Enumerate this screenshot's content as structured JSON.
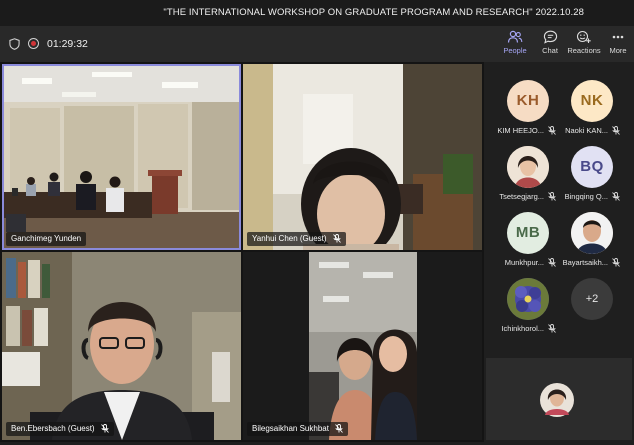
{
  "window": {
    "title": "\"THE INTERNATIONAL WORKSHOP ON GRADUATE PROGRAM AND RESEARCH\" 2022.10.28"
  },
  "toolbar": {
    "timer": "01:29:32",
    "people_label": "People",
    "chat_label": "Chat",
    "reactions_label": "Reactions",
    "more_label": "More"
  },
  "tiles": [
    {
      "name": "Ganchimeg Yunden"
    },
    {
      "name": "Yanhui Chen (Guest)"
    },
    {
      "name": "Ben.Ebersbach (Guest)"
    },
    {
      "name": "Bilegsaikhan Sukhbat"
    }
  ],
  "roster": [
    {
      "initials": "KH",
      "name": "KIM HEEJO...",
      "color": "#f6dcc4",
      "text_color": "#9a5b2c"
    },
    {
      "initials": "NK",
      "name": "Naoki KAN...",
      "color": "#fde8c6",
      "text_color": "#9a6a1e"
    },
    {
      "initials": "",
      "name": "Tsetsegjarg...",
      "color": "#e9c6a8",
      "text_color": "#333"
    },
    {
      "initials": "BQ",
      "name": "Bingqing Q...",
      "color": "#e1e1f3",
      "text_color": "#4a4a8a"
    },
    {
      "initials": "MB",
      "name": "Munkhpur...",
      "color": "#e2ede1",
      "text_color": "#4a6a4a"
    },
    {
      "initials": "",
      "name": "Bayartsaikh...",
      "color": "#d7c3b0",
      "text_color": "#333"
    },
    {
      "initials": "",
      "name": "Ichinkhorol...",
      "color": "#5b5aa8",
      "text_color": "#fff"
    }
  ],
  "overflow": {
    "label": "+2"
  }
}
